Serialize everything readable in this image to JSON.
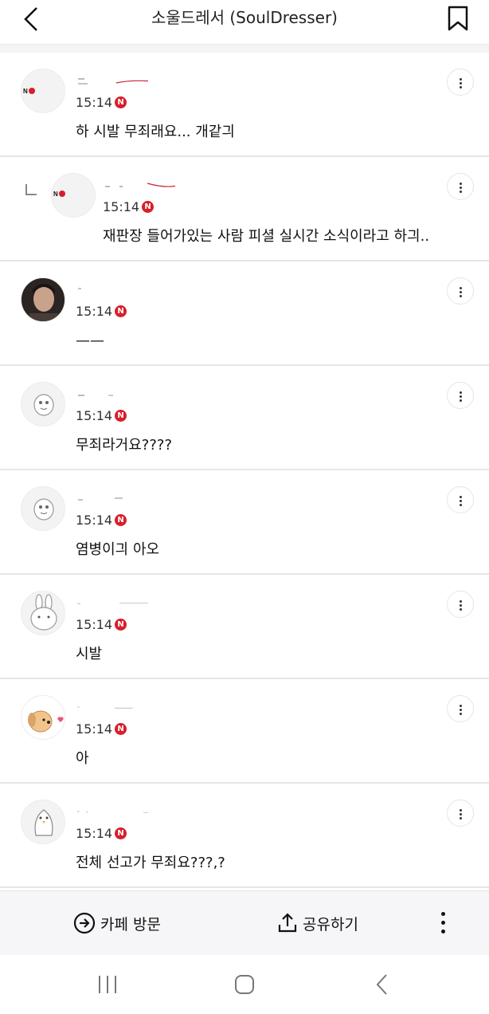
{
  "header": {
    "title": "소울드레서 (SoulDresser)",
    "back_icon": "chevron-left-icon",
    "bookmark_icon": "bookmark-icon"
  },
  "comments": [
    {
      "time": "15:14",
      "badge": "N",
      "text": "하 시발 무죄래요... 개같긔",
      "avatar": "no-logo",
      "reply": false
    },
    {
      "time": "15:14",
      "badge": "N",
      "text": "재판장 들어가있는 사람 피셜 실시간 소식이라고 하긔..",
      "avatar": "no-logo",
      "reply": true
    },
    {
      "time": "15:14",
      "badge": "N",
      "text": "——",
      "avatar": "photo",
      "reply": false
    },
    {
      "time": "15:14",
      "badge": "N",
      "text": "무죄라거요????",
      "avatar": "cartoon",
      "reply": false
    },
    {
      "time": "15:14",
      "badge": "N",
      "text": "염병이긔 아오",
      "avatar": "cartoon",
      "reply": false
    },
    {
      "time": "15:14",
      "badge": "N",
      "text": "시발",
      "avatar": "rabbit",
      "reply": false
    },
    {
      "time": "15:14",
      "badge": "N",
      "text": "아",
      "avatar": "dog",
      "reply": false
    },
    {
      "time": "15:14",
      "badge": "N",
      "text": "전체 선고가 무죄요???,?",
      "avatar": "penguin",
      "reply": false
    }
  ],
  "bottom_bar": {
    "cafe_label": "카페 방문",
    "share_label": "공유하기",
    "cafe_icon": "arrow-circle-right-icon",
    "share_icon": "share-upload-icon",
    "more_icon": "kebab-menu-icon"
  },
  "colors": {
    "badge": "#d81f2a",
    "divider": "#e6e6e6",
    "bottom_bar_bg": "#f6f6f8"
  }
}
